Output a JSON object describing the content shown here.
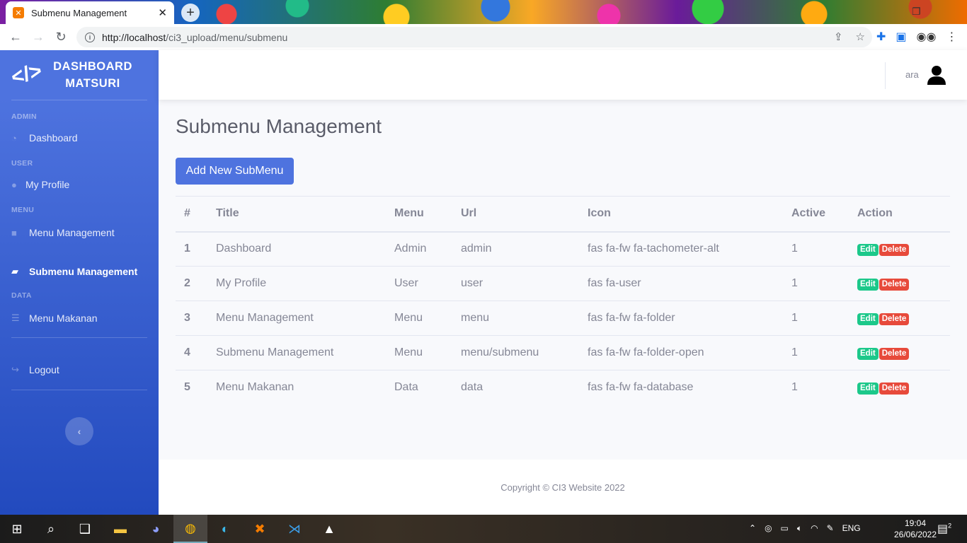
{
  "browser": {
    "tab_title": "Submenu Management",
    "url_host": "http://localhost",
    "url_path": "/ci3_upload/menu/submenu"
  },
  "sidebar": {
    "brand_line1": "DASHBOARD",
    "brand_line2": "MATSURI",
    "headings": [
      "ADMIN",
      "USER",
      "MENU",
      "DATA"
    ],
    "items": [
      {
        "label": "Dashboard",
        "icon": "tachometer-icon"
      },
      {
        "label": "My Profile",
        "icon": "user-icon"
      },
      {
        "label": "Menu Management",
        "icon": "folder-icon"
      },
      {
        "label": "Submenu Management",
        "icon": "folder-open-icon",
        "active": true
      },
      {
        "label": "Menu Makanan",
        "icon": "database-icon"
      },
      {
        "label": "Logout",
        "icon": "sign-out-icon"
      }
    ]
  },
  "topbar": {
    "username": "ara"
  },
  "main": {
    "title": "Submenu Management",
    "add_button": "Add New SubMenu",
    "table": {
      "headers": [
        "#",
        "Title",
        "Menu",
        "Url",
        "Icon",
        "Active",
        "Action"
      ],
      "rows": [
        {
          "num": "1",
          "title": "Dashboard",
          "menu": "Admin",
          "url": "admin",
          "icon": "fas fa-fw fa-tachometer-alt",
          "active": "1"
        },
        {
          "num": "2",
          "title": "My Profile",
          "menu": "User",
          "url": "user",
          "icon": "fas fa-user",
          "active": "1"
        },
        {
          "num": "3",
          "title": "Menu Management",
          "menu": "Menu",
          "url": "menu",
          "icon": "fas fa-fw fa-folder",
          "active": "1"
        },
        {
          "num": "4",
          "title": "Submenu Management",
          "menu": "Menu",
          "url": "menu/submenu",
          "icon": "fas fa-fw fa-folder-open",
          "active": "1"
        },
        {
          "num": "5",
          "title": "Menu Makanan",
          "menu": "Data",
          "url": "data",
          "icon": "fas fa-fw fa-database",
          "active": "1"
        }
      ],
      "edit_label": "Edit",
      "delete_label": "Delete"
    }
  },
  "footer": {
    "text": "Copyright © CI3 Website 2022"
  },
  "taskbar": {
    "lang": "ENG",
    "time": "19:04",
    "date": "26/06/2022",
    "notif_count": "2"
  },
  "colors": {
    "primary": "#4e73df",
    "success": "#1cc88a",
    "danger": "#e74a3b"
  }
}
